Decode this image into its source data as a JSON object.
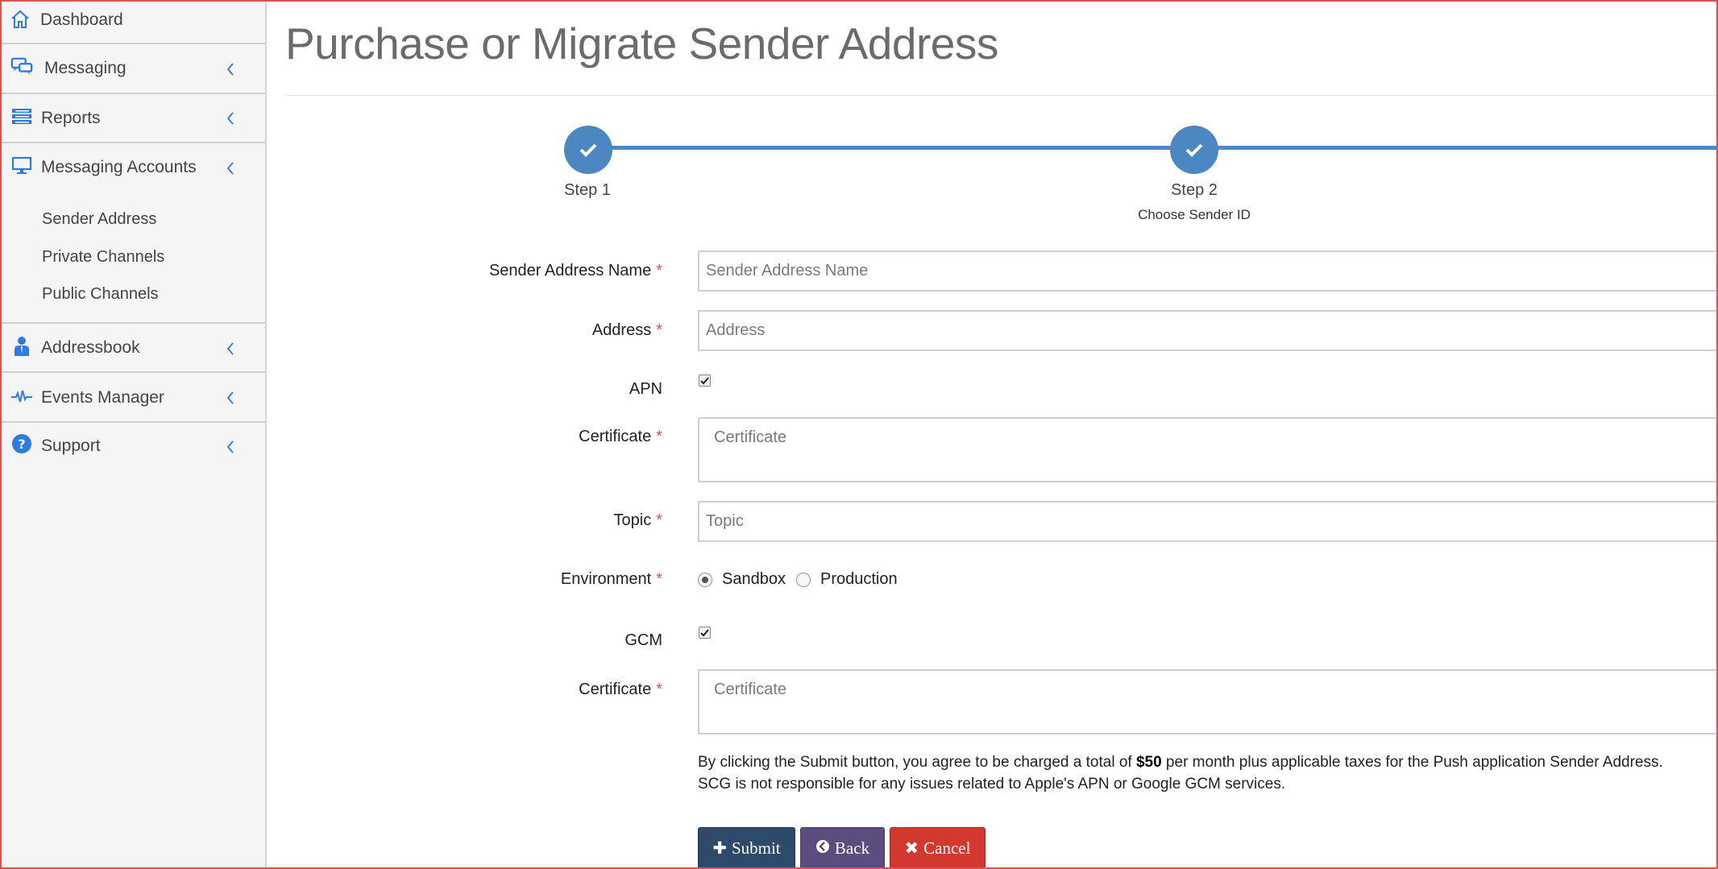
{
  "sidebar": {
    "items": [
      {
        "label": "Dashboard",
        "icon": "home-icon"
      },
      {
        "label": "Messaging",
        "icon": "chat-bubbles-icon"
      },
      {
        "label": "Reports",
        "icon": "list-icon"
      },
      {
        "label": "Messaging Accounts",
        "icon": "monitor-icon"
      },
      {
        "label": "Addressbook",
        "icon": "contact-icon"
      },
      {
        "label": "Events Manager",
        "icon": "pulse-icon"
      },
      {
        "label": "Support",
        "icon": "question-circle-icon"
      }
    ],
    "subitems": [
      "Sender Address",
      "Private Channels",
      "Public Channels"
    ]
  },
  "page": {
    "title": "Purchase or Migrate Sender Address"
  },
  "stepper": {
    "steps": [
      {
        "label": "Step 1",
        "sub": "",
        "complete": true
      },
      {
        "label": "Step 2",
        "sub": "Choose Sender ID",
        "complete": true
      }
    ]
  },
  "form": {
    "required_marker": "*",
    "sender_name": {
      "label": "Sender Address Name",
      "placeholder": "Sender Address Name",
      "value": ""
    },
    "address": {
      "label": "Address",
      "placeholder": "Address",
      "value": ""
    },
    "apn": {
      "label": "APN",
      "checked": true
    },
    "apn_certificate": {
      "label": "Certificate",
      "placeholder": "Certificate"
    },
    "topic": {
      "label": "Topic",
      "placeholder": "Topic",
      "value": ""
    },
    "environment": {
      "label": "Environment",
      "options": [
        "Sandbox",
        "Production"
      ],
      "selected": "Sandbox"
    },
    "gcm": {
      "label": "GCM",
      "checked": true
    },
    "gcm_certificate": {
      "label": "Certificate",
      "placeholder": "Certificate"
    }
  },
  "notice": {
    "part1": "By clicking the Submit button, you agree to be charged a total of ",
    "amount": "$50",
    "part2": " per month plus applicable taxes for the Push application Sender Address.",
    "line2": "SCG is not responsible for any issues related to Apple's APN or Google GCM services."
  },
  "buttons": {
    "submit": {
      "label": "Submit",
      "color": "#2e4a6b"
    },
    "back": {
      "label": "Back",
      "color": "#5b4d7e"
    },
    "cancel": {
      "label": "Cancel",
      "color": "#d2382e"
    }
  },
  "colors": {
    "accent": "#4b88c1",
    "icon_blue": "#2c7be5",
    "required": "#d9534f"
  }
}
